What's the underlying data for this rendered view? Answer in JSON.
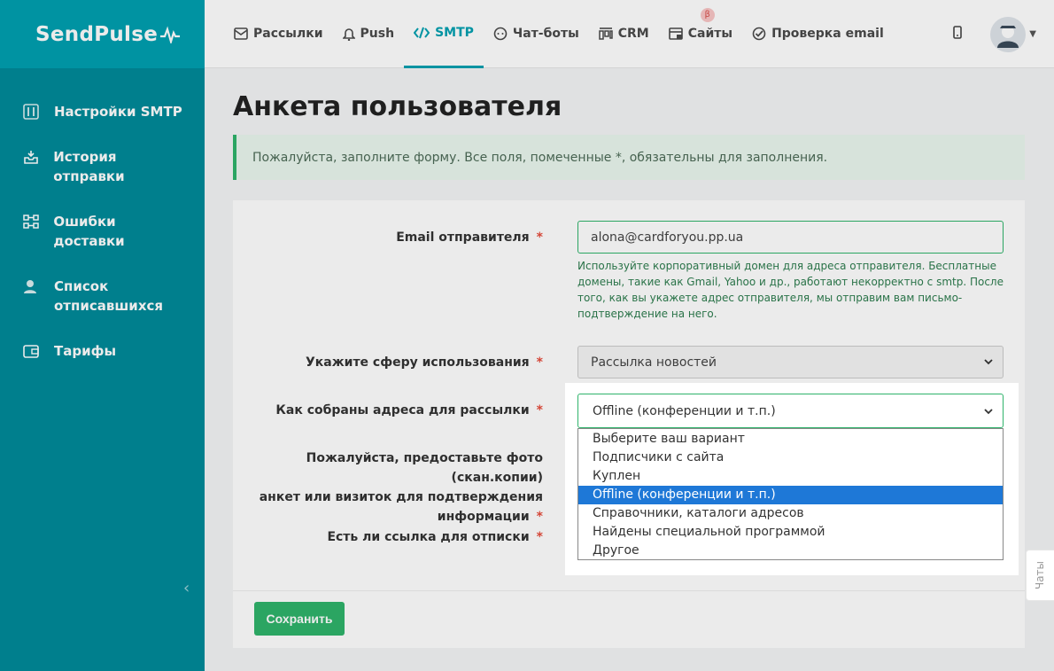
{
  "brand": {
    "logo": "SendPulse"
  },
  "topnav": [
    {
      "label": "Рассылки",
      "icon": "mail-icon"
    },
    {
      "label": "Push",
      "icon": "bell-icon"
    },
    {
      "label": "SMTP",
      "icon": "code-icon",
      "active": true
    },
    {
      "label": "Чат-боты",
      "icon": "chat-icon"
    },
    {
      "label": "CRM",
      "icon": "crm-icon"
    },
    {
      "label": "Сайты",
      "icon": "site-icon",
      "badge": "β"
    },
    {
      "label": "Проверка email",
      "icon": "check-circle-icon"
    }
  ],
  "sidebar": {
    "items": [
      {
        "label": "Настройки SMTP",
        "icon": "sliders-icon"
      },
      {
        "label": "История отправки",
        "icon": "inbox-icon"
      },
      {
        "label": "Ошибки доставки",
        "icon": "flow-icon"
      },
      {
        "label": "Список отписавшихся",
        "icon": "user-remove-icon"
      },
      {
        "label": "Тарифы",
        "icon": "wallet-icon"
      }
    ]
  },
  "page": {
    "title": "Анкета пользователя",
    "alert": "Пожалуйста, заполните форму. Все поля, помеченные *, обязательны для заполнения."
  },
  "form": {
    "email_label": "Email отправителя",
    "email_value": "alona@cardforyou.pp.ua",
    "email_hint": "Используйте корпоративный домен для адреса отправителя. Бесплатные домены, такие как Gmail, Yahoo и др., работают некорректно с smtp. После того, как вы укажете адрес отправителя, мы отправим вам письмо-подтверждение на него.",
    "usage_label": "Укажите сферу использования",
    "usage_value": "Рассылка новостей",
    "collect_label": "Как собраны адреса для рассылки",
    "collect_value": "Offline (конференции и т.п.)",
    "collect_options": [
      "Выберите ваш вариант",
      "Подписчики с сайта",
      "Куплен",
      "Offline (конференции и т.п.)",
      "Справочники, каталоги адресов",
      "Найдены специальной программой",
      "Другое"
    ],
    "collect_selected_index": 3,
    "photo_label_line1": "Пожалуйста, предоставьте фото (скан.копии)",
    "photo_label_line2": "анкет или визиток для подтверждения",
    "photo_label_line3": "информации",
    "unsub_label": "Есть ли ссылка для отписки",
    "required_mark": "*",
    "save_label": "Сохранить"
  },
  "chats_tab": "Чаты",
  "colors": {
    "accent": "#00a0b0",
    "sidebar": "#008a99",
    "success": "#2fb36b",
    "selected_option": "#1e78d7"
  }
}
